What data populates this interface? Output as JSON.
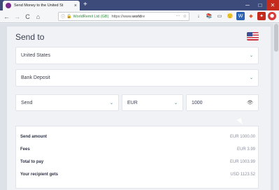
{
  "browser": {
    "tab_title": "Send Money to the United St",
    "tab_close": "×",
    "new_tab": "+",
    "back": "←",
    "forward": "→",
    "reload": "C",
    "home": "⌂",
    "info": "ⓘ",
    "lock": "🔒",
    "org": "WorldRemit Ltd (GB)",
    "url_prefix": "https://www.",
    "url_host": "world",
    "url_rest": "re",
    "url_more": "···",
    "url_star": "☆",
    "toolbar_icons": [
      "↓",
      "📚",
      "▭",
      "🙂",
      "W",
      "◆",
      "✦",
      "⬣",
      "☰"
    ],
    "win_min": "─",
    "win_max": "□",
    "win_close": "✕"
  },
  "form": {
    "title": "Send to",
    "country": "United States",
    "method": "Bank Deposit",
    "send_type": "Send",
    "currency": "EUR",
    "amount": "1000",
    "chevron": "⌄",
    "eye": "👁"
  },
  "summary": {
    "rows": [
      {
        "label": "Send amount",
        "value": "EUR 1000.00"
      },
      {
        "label": "Fees",
        "value": "EUR 3.99"
      },
      {
        "label": "Total to pay",
        "value": "EUR 1003.99"
      },
      {
        "label": "Your recipient gets",
        "value": "USD 1123.52"
      }
    ]
  },
  "colors": {
    "titlebar": "#3c4b7a",
    "accent": "#2a7a8a",
    "secure_green": "#2e8b3d"
  }
}
